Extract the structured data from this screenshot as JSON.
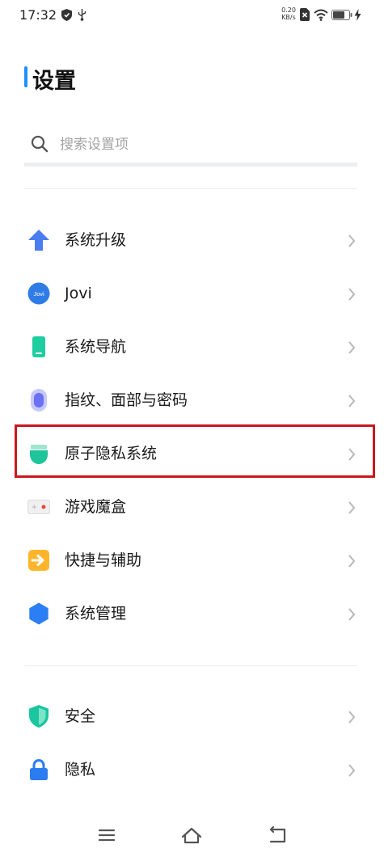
{
  "status_bar": {
    "time": "17:32",
    "net_speed_value": "0.20",
    "net_speed_unit": "KB/s",
    "icons": [
      "shield-icon",
      "usb-icon",
      "sim-x-icon",
      "wifi-icon",
      "battery-icon",
      "charging-icon"
    ]
  },
  "header": {
    "title": "设置",
    "accent_color": "#1e90ff"
  },
  "search": {
    "placeholder": "搜索设置项"
  },
  "groups": [
    {
      "items": [
        {
          "label": "系统升级",
          "icon": "system-update-icon"
        },
        {
          "label": "Jovi",
          "icon": "jovi-icon",
          "icon_text": "Jovi"
        },
        {
          "label": "系统导航",
          "icon": "system-navigation-icon"
        },
        {
          "label": "指纹、面部与密码",
          "icon": "fingerprint-icon"
        },
        {
          "label": "原子隐私系统",
          "icon": "atomic-privacy-icon",
          "highlighted": true
        },
        {
          "label": "游戏魔盒",
          "icon": "game-box-icon"
        },
        {
          "label": "快捷与辅助",
          "icon": "shortcut-icon"
        },
        {
          "label": "系统管理",
          "icon": "system-management-icon"
        }
      ]
    },
    {
      "items": [
        {
          "label": "安全",
          "icon": "security-shield-icon"
        },
        {
          "label": "隐私",
          "icon": "privacy-lock-icon"
        }
      ]
    }
  ],
  "highlight_color": "#c8181e",
  "nav_bar": {
    "buttons": [
      "menu-icon",
      "home-icon",
      "back-icon"
    ]
  }
}
